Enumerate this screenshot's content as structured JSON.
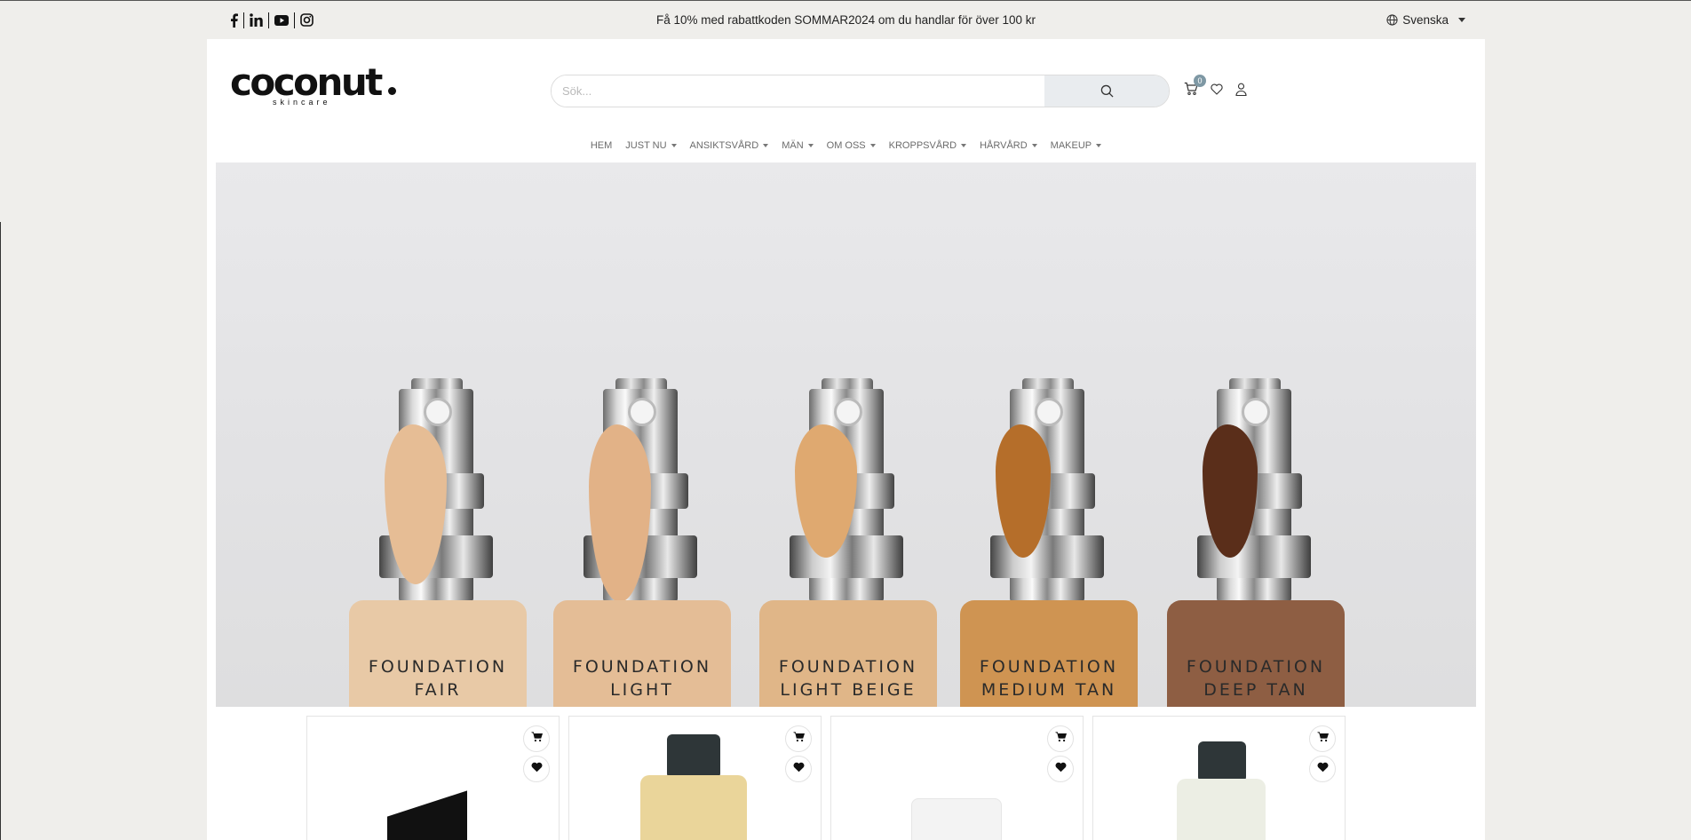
{
  "announcement": {
    "text": "Få 10% med rabattkoden SOMMAR2024 om du handlar för över 100 kr",
    "language": "Svenska",
    "socials": [
      "facebook-icon",
      "linkedin-icon",
      "youtube-icon",
      "instagram-icon"
    ]
  },
  "header": {
    "logo_main": "coconut",
    "logo_sub": "skincare",
    "search_placeholder": "Sök...",
    "cart_count": "0"
  },
  "nav": {
    "items": [
      {
        "label": "HEM",
        "dropdown": false
      },
      {
        "label": "JUST NU",
        "dropdown": true
      },
      {
        "label": "ANSIKTSVÅRD",
        "dropdown": true
      },
      {
        "label": "MÄN",
        "dropdown": true
      },
      {
        "label": "OM OSS",
        "dropdown": true
      },
      {
        "label": "KROPPSVÅRD",
        "dropdown": true
      },
      {
        "label": "HÅRVÅRD",
        "dropdown": true
      },
      {
        "label": "MAKEUP",
        "dropdown": true
      }
    ]
  },
  "hero": {
    "bottles": [
      {
        "line1": "FOUNDATION",
        "line2": "FAIR",
        "body": "#e8c9a6",
        "cream": "#e6bd95"
      },
      {
        "line1": "FOUNDATION",
        "line2": "LIGHT",
        "body": "#e4bd96",
        "cream": "#e2b287"
      },
      {
        "line1": "FOUNDATION",
        "line2": "LIGHT BEIGE",
        "body": "#e0b688",
        "cream": "#dfa970"
      },
      {
        "line1": "FOUNDATION",
        "line2": "MEDIUM TAN",
        "body": "#cf9452",
        "cream": "#b56e2a"
      },
      {
        "line1": "FOUNDATION",
        "line2": "DEEP TAN",
        "body": "#8e5e43",
        "cream": "#5a2e1a"
      }
    ]
  },
  "products": {
    "cards": [
      {
        "name": "product-card-1"
      },
      {
        "name": "product-card-2"
      },
      {
        "name": "product-card-3"
      },
      {
        "name": "product-card-4"
      }
    ]
  },
  "colors": {
    "announce_bg": "#efeeeb",
    "badge": "#7e98a4",
    "search_button_bg": "#e9ecef"
  }
}
